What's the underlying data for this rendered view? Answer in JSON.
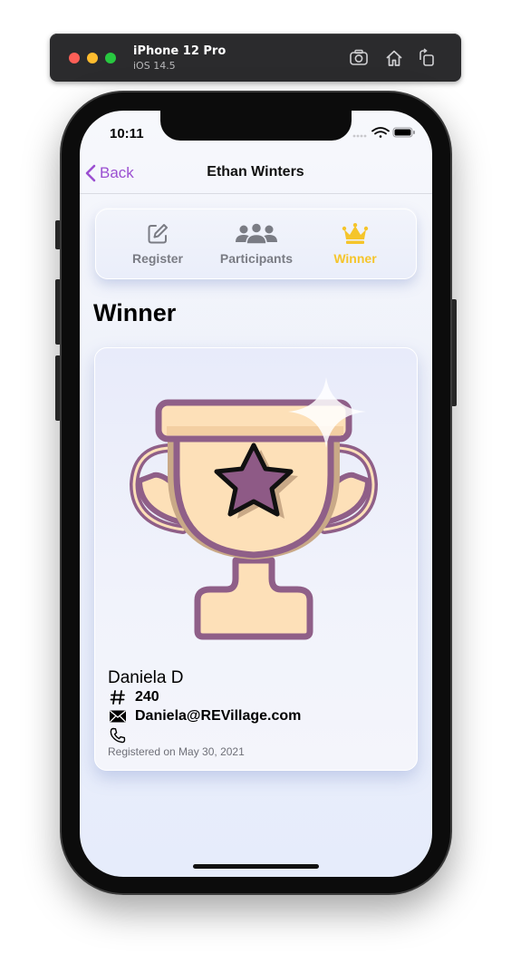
{
  "simulator": {
    "device_name": "iPhone 12 Pro",
    "os_version": "iOS 14.5",
    "toolbar_icons": [
      "screenshot-icon",
      "home-icon",
      "rotate-icon"
    ]
  },
  "status_bar": {
    "time": "10:11"
  },
  "nav": {
    "back_label": "Back",
    "title": "Ethan Winters"
  },
  "tabs": [
    {
      "label": "Register",
      "icon": "edit-icon",
      "active": false
    },
    {
      "label": "Participants",
      "icon": "people-icon",
      "active": false
    },
    {
      "label": "Winner",
      "icon": "crown-icon",
      "active": true
    }
  ],
  "page": {
    "heading": "Winner"
  },
  "winner": {
    "name": "Daniela D",
    "number": "240",
    "email": "Daniela@REVillage.com",
    "phone": "",
    "registered": "Registered on May 30, 2021"
  },
  "colors": {
    "accent": "#9b4fd1",
    "active_tab": "#f5c52b",
    "inactive_tab": "#7a7c84",
    "trophy_fill": "#fde0b8",
    "trophy_outline": "#8f5f88",
    "star": "#8e5a86"
  }
}
